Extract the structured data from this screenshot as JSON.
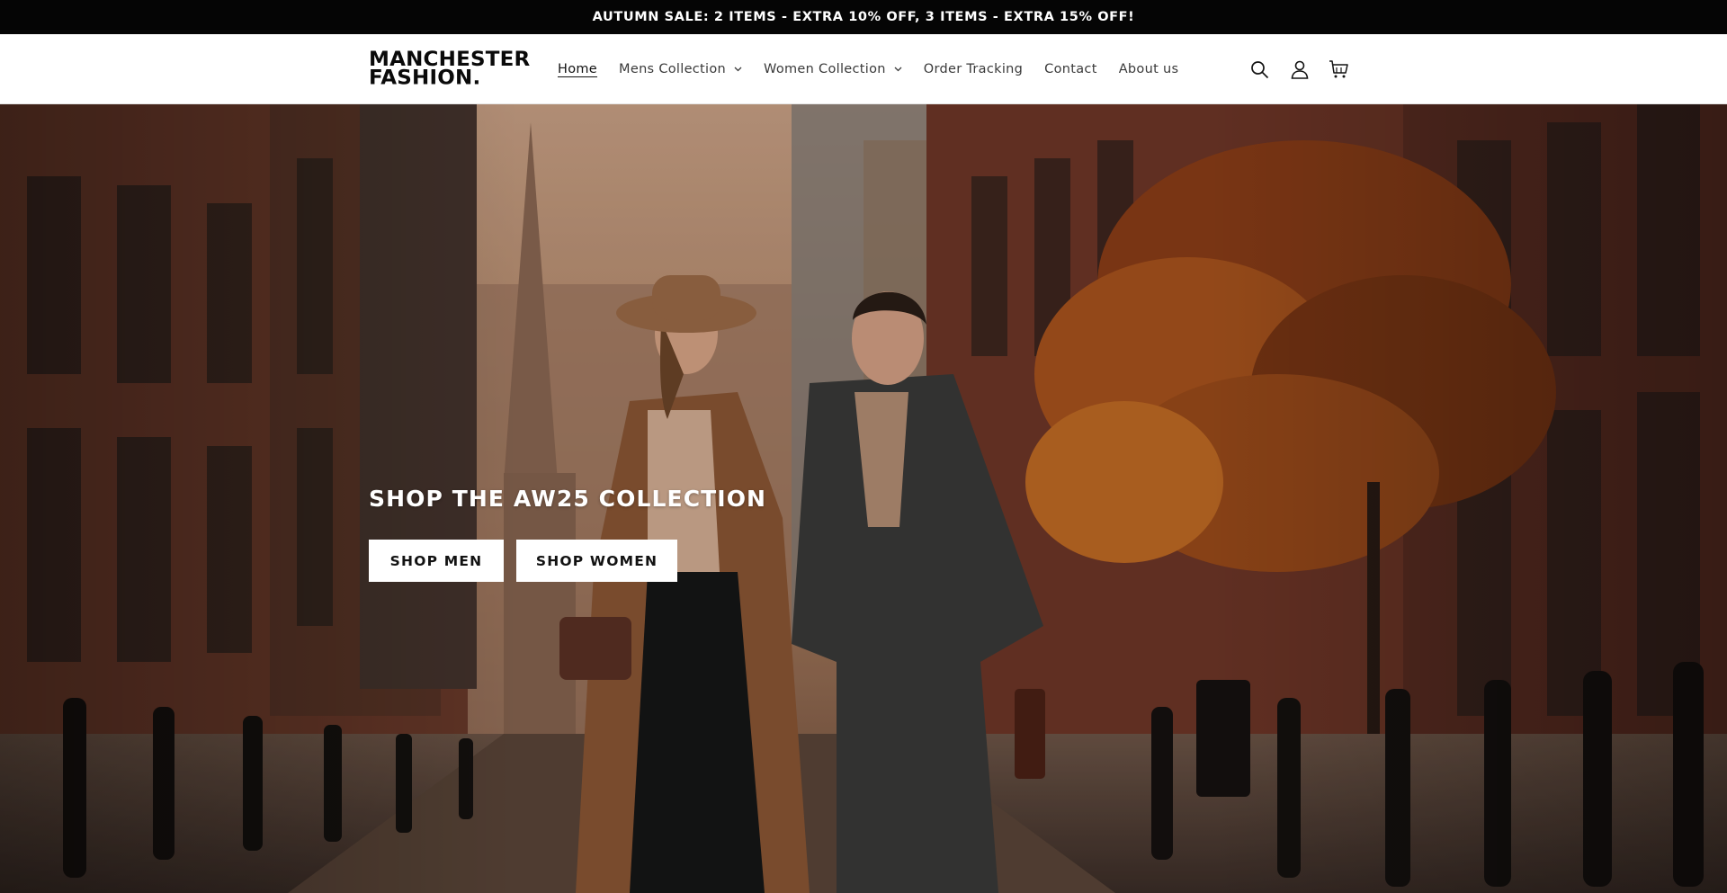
{
  "announcement": {
    "text": "AUTUMN SALE: 2 ITEMS - EXTRA 10% OFF, 3 ITEMS - EXTRA 15% OFF!"
  },
  "header": {
    "logo": {
      "line1": "MANCHESTER",
      "line2": "FASHION."
    },
    "nav": [
      {
        "label": "Home",
        "active": true
      },
      {
        "label": "Mens Collection",
        "dropdown": true
      },
      {
        "label": "Women Collection",
        "dropdown": true
      },
      {
        "label": "Order Tracking"
      },
      {
        "label": "Contact"
      },
      {
        "label": "About us"
      }
    ],
    "icons": [
      "search-icon",
      "account-icon",
      "cart-icon"
    ]
  },
  "hero": {
    "title": "SHOP THE AW25 COLLECTION",
    "buttons": [
      {
        "label": "SHOP MEN"
      },
      {
        "label": "SHOP WOMEN"
      }
    ]
  },
  "colors": {
    "announcement_bg": "#050505",
    "text": "#121212",
    "button_bg": "#ffffff"
  }
}
